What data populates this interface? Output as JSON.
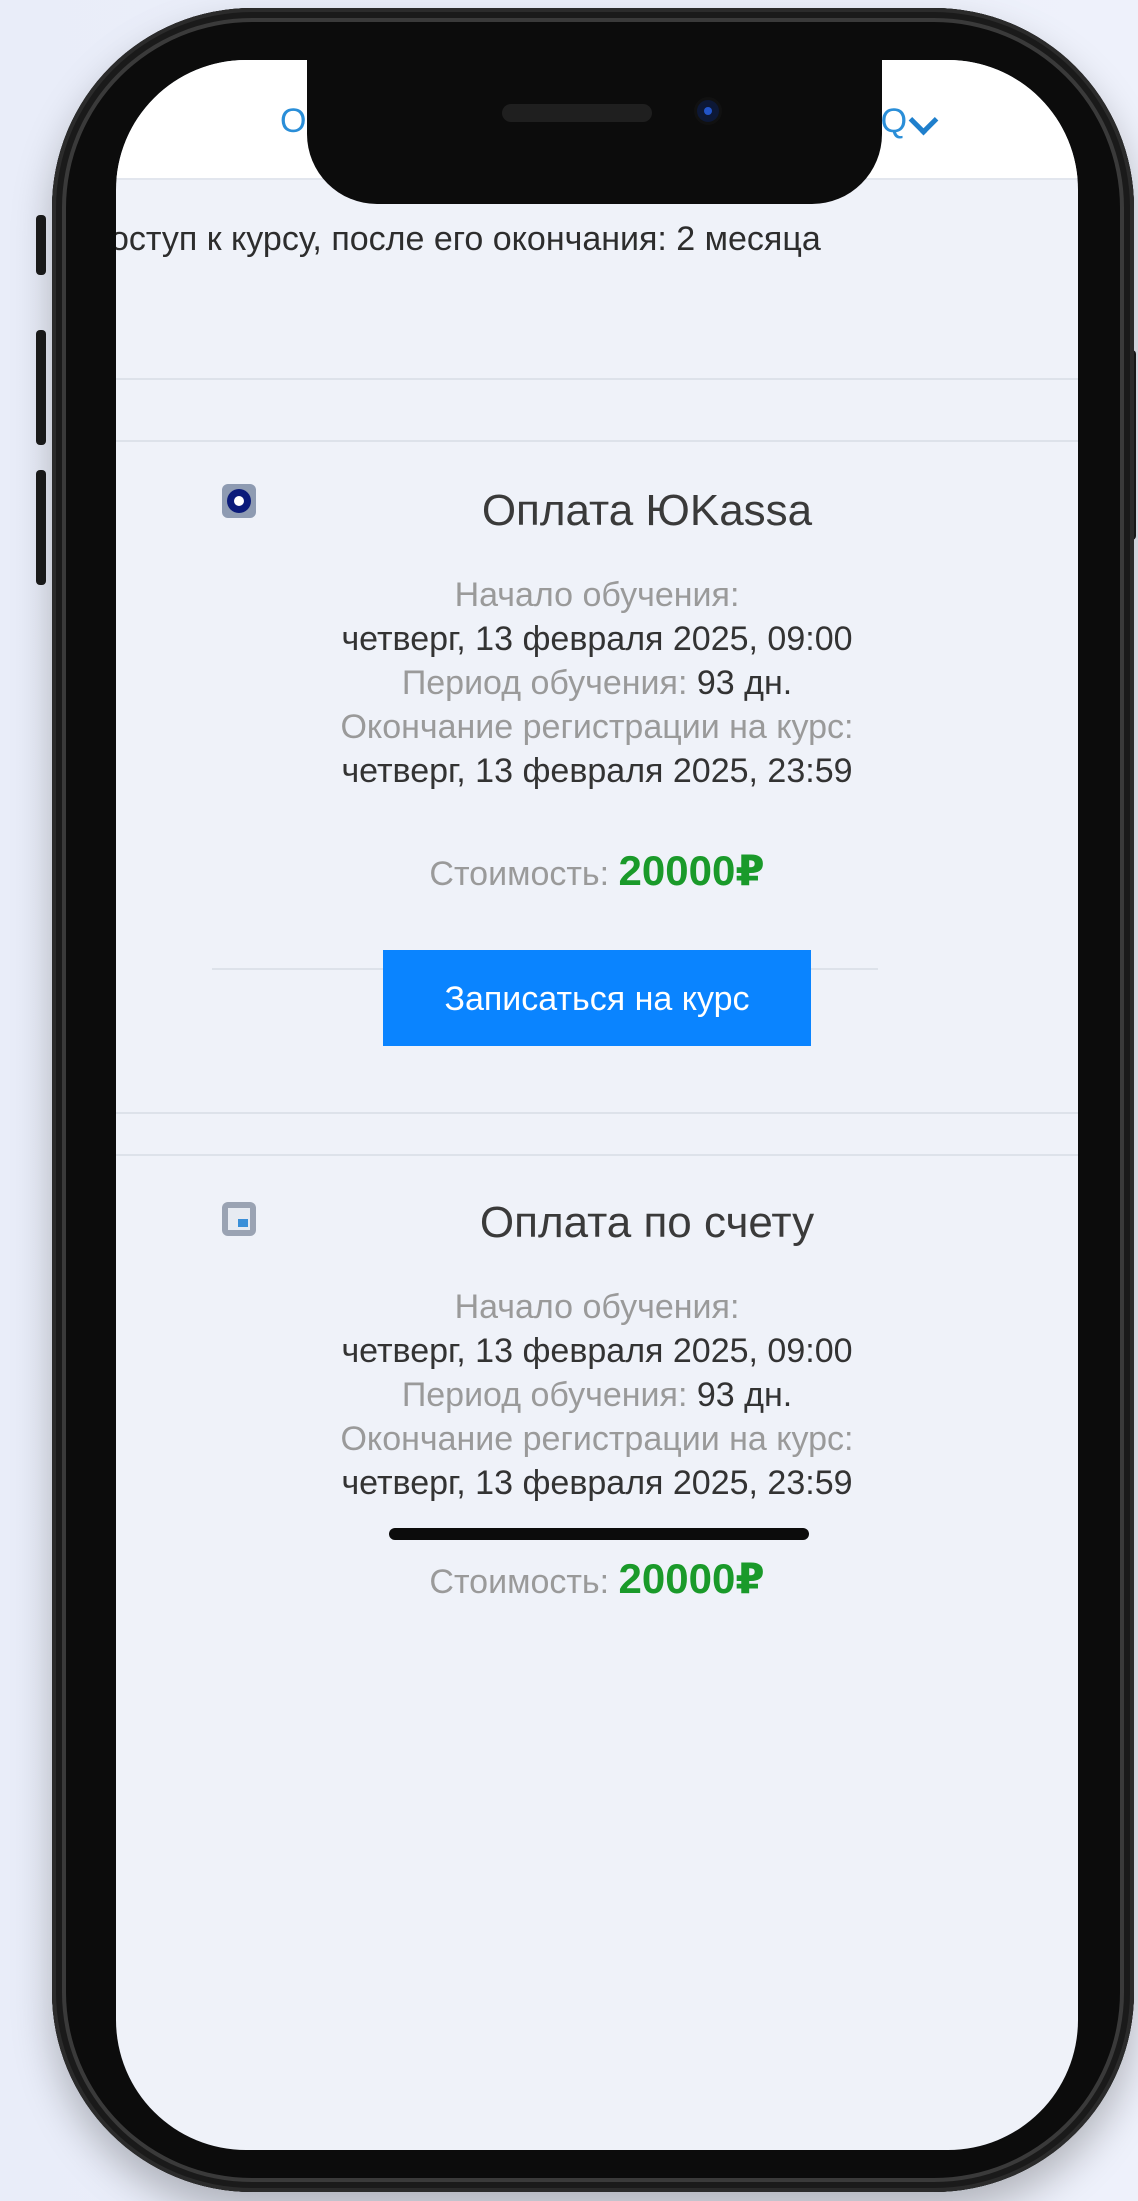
{
  "nav": {
    "left_link": "Обр",
    "right_link": "AQ",
    "dropdown_icon": "chevron-down-icon"
  },
  "access_text": "оступ к курсу, после его окончания: 2 месяца",
  "cards": [
    {
      "icon": "yookassa-icon",
      "title": "Оплата ЮKassa",
      "start_label": "Начало обучения:",
      "start_value": "четверг, 13 февраля 2025, 09:00",
      "period_label": "Период обучения:",
      "period_value": "93 дн.",
      "reg_end_label": "Окончание регистрации на курс:",
      "reg_end_value": "четверг, 13 февраля 2025, 23:59",
      "price_label": "Стоимость:",
      "price_value": "20000₽",
      "button_label": "Записаться на курс"
    },
    {
      "icon": "invoice-icon",
      "title": "Оплата по счету",
      "start_label": "Начало обучения:",
      "start_value": "четверг, 13 февраля 2025, 09:00",
      "period_label": "Период обучения:",
      "period_value": "93 дн.",
      "reg_end_label": "Окончание регистрации на курс:",
      "reg_end_value": "четверг, 13 февраля 2025, 23:59",
      "price_label": "Стоимость:",
      "price_value": "20000₽"
    }
  ],
  "colors": {
    "accent_blue": "#0a84ff",
    "link_blue": "#2a8ed8",
    "price_green": "#1a9a2a",
    "screen_bg": "#eff2f9"
  }
}
